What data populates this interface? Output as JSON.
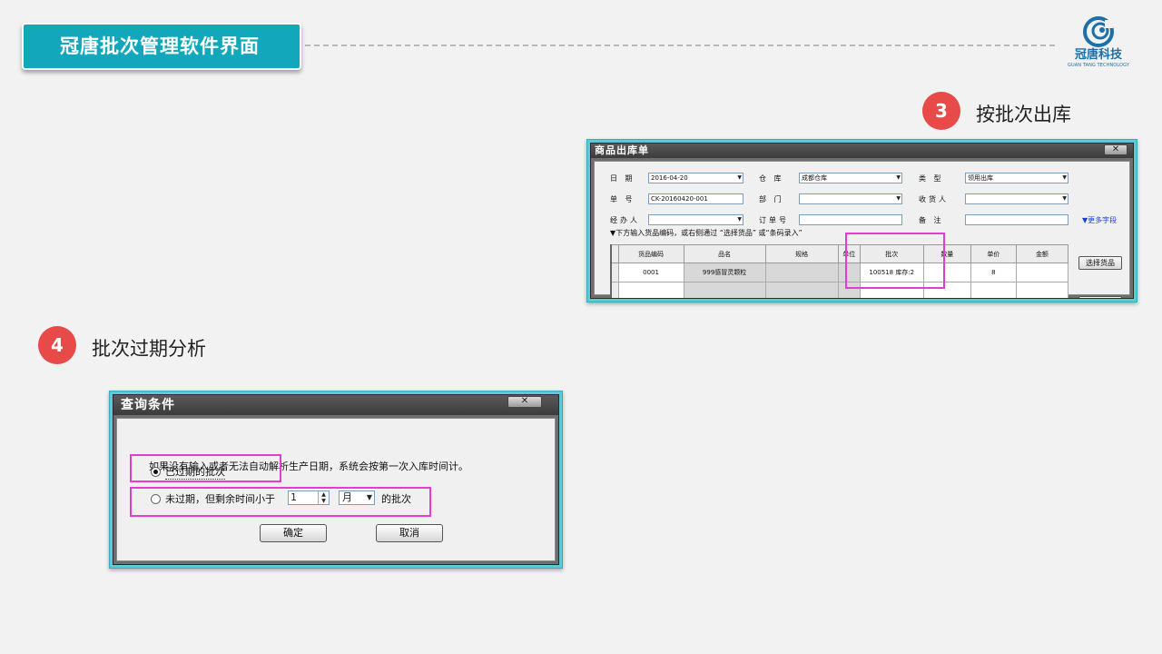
{
  "slide": {
    "title": "冠唐批次管理软件界面"
  },
  "logo": {
    "cn": "冠唐科技",
    "en": "GUAN TANG TECHNOLOGY"
  },
  "step3": {
    "number": "3",
    "label": "按批次出库"
  },
  "step4": {
    "number": "4",
    "label": "批次过期分析"
  },
  "outbound": {
    "window_title": "商品出库单",
    "close": "✕",
    "date_label": "日 期",
    "date_value": "2016-04-20",
    "warehouse_label": "仓 库",
    "warehouse_value": "成都仓库",
    "type_label": "类 型",
    "type_value": "领用出库",
    "order_no_label": "单 号",
    "order_no_value": "CK-20160420-001",
    "dept_label": "部 门",
    "dept_value": "",
    "receiver_label": "收货人",
    "receiver_value": "",
    "handler_label": "经办人",
    "handler_value": "",
    "po_label": "订单号",
    "po_value": "",
    "remark_label": "备 注",
    "remark_value": "",
    "more_fields": "▼更多字段",
    "hint": "▼下方输入货品编码，或右侧通过 “选择货品” 或“条码录入”",
    "columns": [
      "货品编码",
      "品名",
      "规格",
      "单位",
      "批次",
      "数量",
      "单价",
      "金额"
    ],
    "rows": [
      [
        "0001",
        "999感冒灵颗粒",
        "",
        "",
        "100518  库存:2",
        "",
        "8",
        ""
      ]
    ],
    "select_goods_button": "选择货品"
  },
  "query": {
    "window_title": "查询条件",
    "close": "✕",
    "description": "如果没有输入或者无法自动解析生产日期，系统会按第一次入库时间计。",
    "option_expired": "已过期的批次",
    "option_not_expired_prefix": "未过期，但剩余时间小于",
    "remaining_value": "1",
    "unit_value": "月",
    "option_not_expired_suffix": "的批次",
    "ok_button": "确定",
    "cancel_button": "取消"
  },
  "colors": {
    "accent": "#12a7bb",
    "badge": "#e84a4a",
    "highlight": "#e33bd3",
    "window_frame": "#5cc9d8"
  }
}
